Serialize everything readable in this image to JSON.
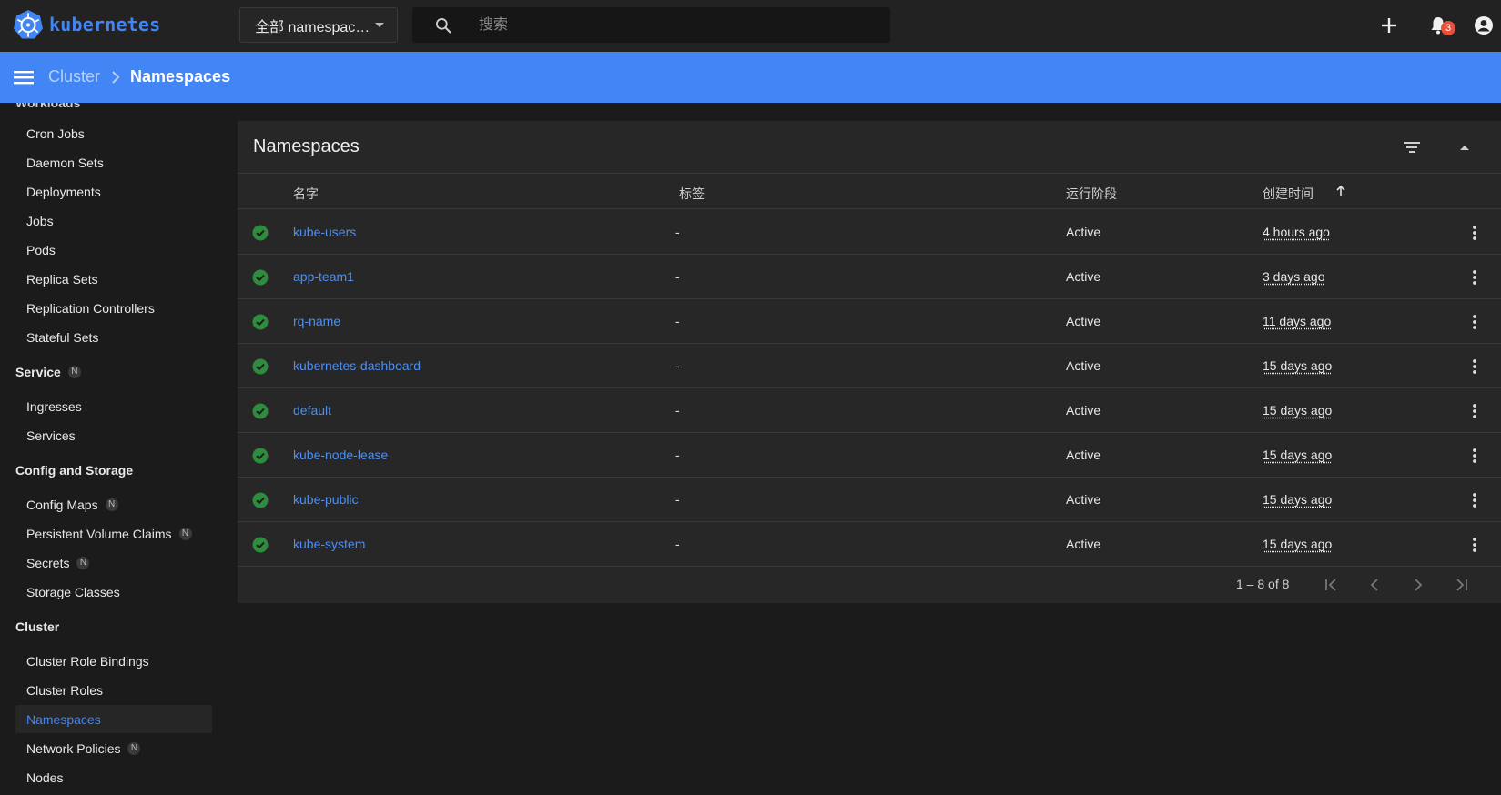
{
  "app": {
    "name": "kubernetes",
    "brand_color": "#4285f4"
  },
  "topbar": {
    "namespace_selector": "全部 namespac…",
    "search_placeholder": "搜索",
    "notifications_count": "3"
  },
  "breadcrumb": {
    "root": "Cluster",
    "current": "Namespaces"
  },
  "sidebar": {
    "cut_heading": "Workloads",
    "workloads": [
      "Cron Jobs",
      "Daemon Sets",
      "Deployments",
      "Jobs",
      "Pods",
      "Replica Sets",
      "Replication Controllers",
      "Stateful Sets"
    ],
    "service_heading": "Service",
    "service_badge": "N",
    "service_items": [
      "Ingresses",
      "Services"
    ],
    "config_heading": "Config and Storage",
    "config_items": [
      {
        "label": "Config Maps",
        "badge": "N"
      },
      {
        "label": "Persistent Volume Claims",
        "badge": "N"
      },
      {
        "label": "Secrets",
        "badge": "N"
      },
      {
        "label": "Storage Classes",
        "badge": ""
      }
    ],
    "cluster_heading": "Cluster",
    "cluster_items": [
      {
        "label": "Cluster Role Bindings",
        "badge": ""
      },
      {
        "label": "Cluster Roles",
        "badge": ""
      },
      {
        "label": "Namespaces",
        "badge": ""
      },
      {
        "label": "Network Policies",
        "badge": "N"
      },
      {
        "label": "Nodes",
        "badge": ""
      }
    ]
  },
  "card": {
    "title": "Namespaces",
    "columns": {
      "name": "名字",
      "labels": "标签",
      "phase": "运行阶段",
      "created": "创建时间"
    },
    "rows": [
      {
        "name": "kube-users",
        "labels": "-",
        "phase": "Active",
        "age": "4 hours ago"
      },
      {
        "name": "app-team1",
        "labels": "-",
        "phase": "Active",
        "age": "3 days ago"
      },
      {
        "name": "rq-name",
        "labels": "-",
        "phase": "Active",
        "age": "11 days ago"
      },
      {
        "name": "kubernetes-dashboard",
        "labels": "-",
        "phase": "Active",
        "age": "15 days ago"
      },
      {
        "name": "default",
        "labels": "-",
        "phase": "Active",
        "age": "15 days ago"
      },
      {
        "name": "kube-node-lease",
        "labels": "-",
        "phase": "Active",
        "age": "15 days ago"
      },
      {
        "name": "kube-public",
        "labels": "-",
        "phase": "Active",
        "age": "15 days ago"
      },
      {
        "name": "kube-system",
        "labels": "-",
        "phase": "Active",
        "age": "15 days ago"
      }
    ],
    "pager_range": "1 – 8 of 8"
  }
}
